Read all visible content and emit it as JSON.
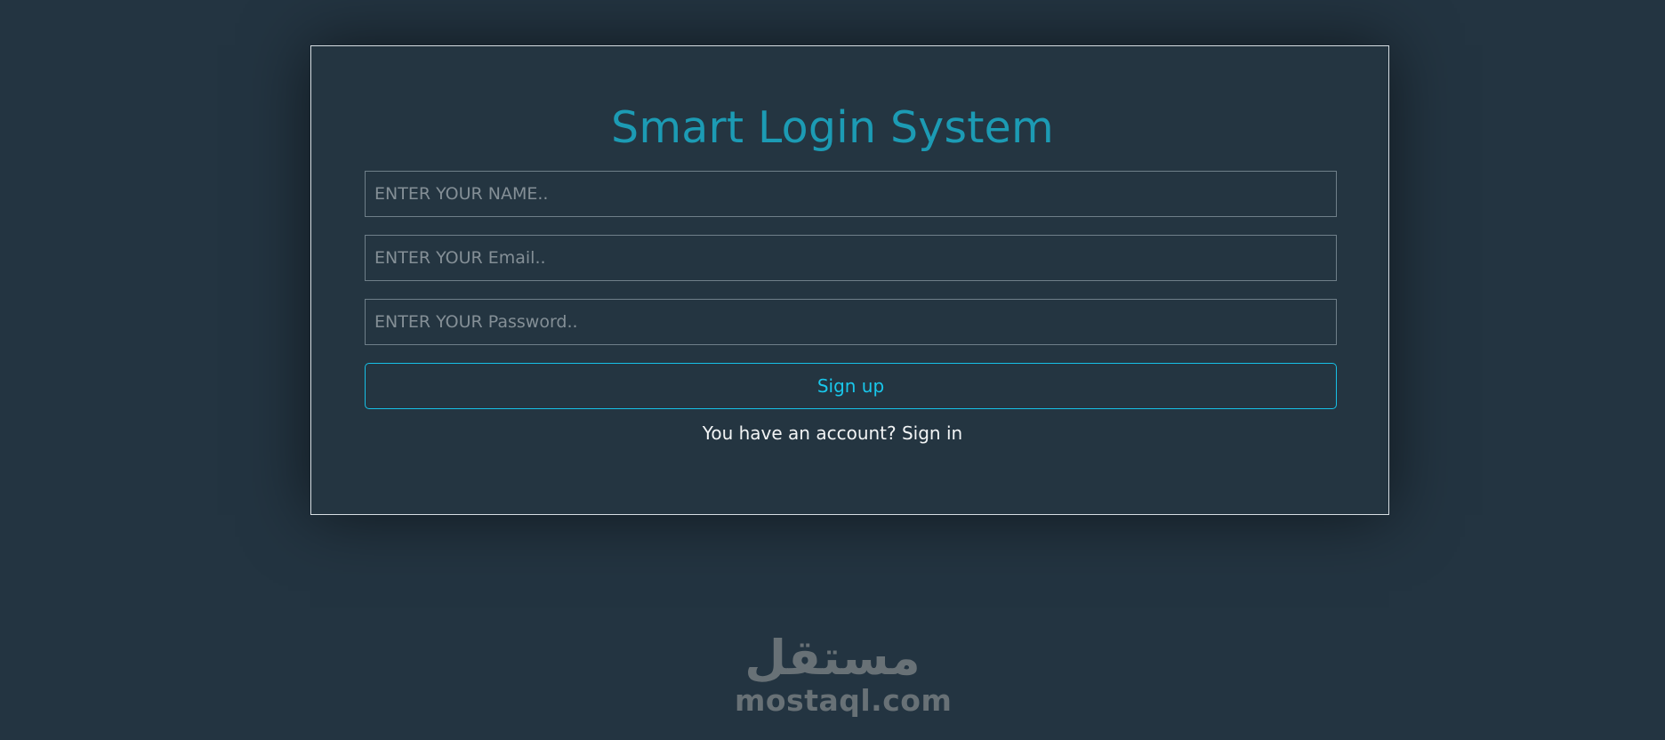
{
  "app": {
    "title": "Smart Login System"
  },
  "form": {
    "name_placeholder": "ENTER YOUR NAME..",
    "email_placeholder": "ENTER YOUR Email..",
    "password_placeholder": "ENTER YOUR Password..",
    "name_value": "",
    "email_value": "",
    "password_value": "",
    "signup_label": "Sign up",
    "account_prompt": "You have an account? ",
    "signin_label": "Sign in"
  },
  "watermark": {
    "arabic": "مستقل",
    "latin": "mostaql.com"
  },
  "colors": {
    "background": "#233441",
    "accent": "#1c9bb4",
    "button_accent": "#19c7eb",
    "text": "#f2f4f5"
  }
}
